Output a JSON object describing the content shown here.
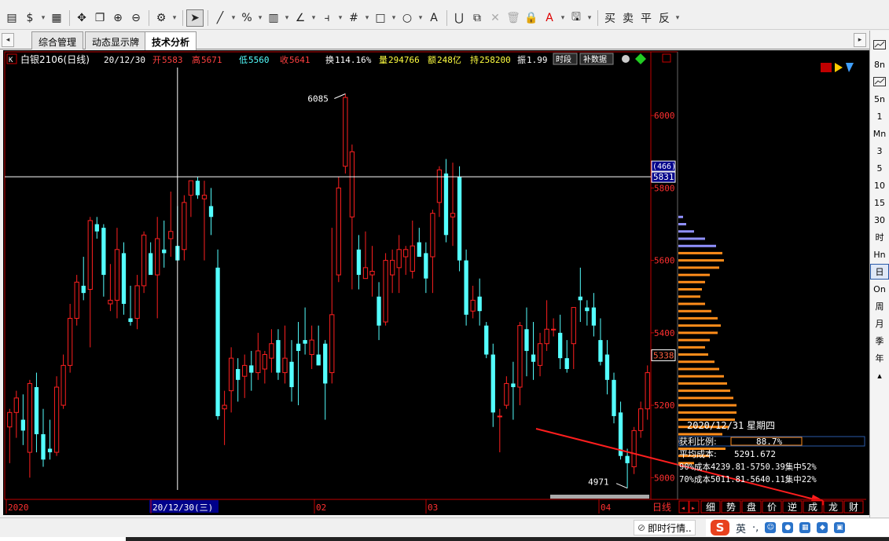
{
  "toolbar": {
    "items": [
      {
        "name": "document-icon",
        "glyph": "▤"
      },
      {
        "name": "currency-icon",
        "glyph": "$"
      },
      {
        "name": "currency-dropdown-icon",
        "glyph": "▾",
        "small": true
      },
      {
        "name": "grid-icon",
        "glyph": "▦"
      },
      {
        "name": "sep"
      },
      {
        "name": "move-icon",
        "glyph": "✥"
      },
      {
        "name": "copy-icon",
        "glyph": "❐"
      },
      {
        "name": "zoom-in-icon",
        "glyph": "⊕"
      },
      {
        "name": "zoom-out-icon",
        "glyph": "⊖"
      },
      {
        "name": "sep"
      },
      {
        "name": "settings-icon",
        "glyph": "⚙"
      },
      {
        "name": "settings-dropdown-icon",
        "glyph": "▾",
        "small": true
      },
      {
        "name": "sep"
      },
      {
        "name": "pointer-icon",
        "glyph": "➤",
        "active": true
      },
      {
        "name": "sep"
      },
      {
        "name": "line-tool-icon",
        "glyph": "╱"
      },
      {
        "name": "line-dropdown-icon",
        "glyph": "▾",
        "small": true
      },
      {
        "name": "percent-icon",
        "glyph": "%"
      },
      {
        "name": "percent-dropdown-icon",
        "glyph": "▾",
        "small": true
      },
      {
        "name": "ruler-icon",
        "glyph": "▥"
      },
      {
        "name": "ruler-dropdown-icon",
        "glyph": "▾",
        "small": true
      },
      {
        "name": "angle-icon",
        "glyph": "∠"
      },
      {
        "name": "angle-dropdown-icon",
        "glyph": "▾",
        "small": true
      },
      {
        "name": "fork-icon",
        "glyph": "⫞"
      },
      {
        "name": "fork-dropdown-icon",
        "glyph": "▾",
        "small": true
      },
      {
        "name": "hash-icon",
        "glyph": "#"
      },
      {
        "name": "hash-dropdown-icon",
        "glyph": "▾",
        "small": true
      },
      {
        "name": "rectangle-icon",
        "glyph": "□"
      },
      {
        "name": "rectangle-dropdown-icon",
        "glyph": "▾",
        "small": true
      },
      {
        "name": "circle-icon",
        "glyph": "○"
      },
      {
        "name": "circle-dropdown-icon",
        "glyph": "▾",
        "small": true
      },
      {
        "name": "text-icon",
        "glyph": "A"
      },
      {
        "name": "sep"
      },
      {
        "name": "magnet-icon",
        "glyph": "⋃"
      },
      {
        "name": "copy-shape-icon",
        "glyph": "⧉"
      },
      {
        "name": "delete-icon",
        "glyph": "✕",
        "gray": true
      },
      {
        "name": "trash-icon",
        "glyph": "🗑",
        "gray": true
      },
      {
        "name": "lock-icon",
        "glyph": "🔒"
      },
      {
        "name": "color-icon",
        "glyph": "A",
        "red": true
      },
      {
        "name": "color-dropdown-icon",
        "glyph": "▾",
        "small": true
      },
      {
        "name": "save-icon",
        "glyph": "🖫"
      },
      {
        "name": "save-dropdown-icon",
        "glyph": "▾",
        "small": true
      },
      {
        "name": "sep"
      },
      {
        "name": "buy-icon",
        "glyph": "买"
      },
      {
        "name": "sell-icon",
        "glyph": "卖"
      },
      {
        "name": "close-position-icon",
        "glyph": "平"
      },
      {
        "name": "reverse-icon",
        "glyph": "反"
      },
      {
        "name": "trade-dropdown-icon",
        "glyph": "▾",
        "small": true
      }
    ]
  },
  "tabs": {
    "left_arrow": "◂",
    "right_arrow": "▸",
    "items": [
      "综合管理",
      "动态显示牌",
      "技术分析"
    ],
    "active_index": 2
  },
  "info_bar": {
    "k_button": "K",
    "instrument": "白银2106(日线)",
    "date": "20/12/30",
    "open_label": "开",
    "open": "5583",
    "high_label": "高",
    "high": "5671",
    "low_label": "低",
    "low": "5560",
    "close_label": "收",
    "close": "5641",
    "turnover_label": "换",
    "turnover": "114.16%",
    "volume_label": "量",
    "volume": "294766",
    "amount_label": "额",
    "amount": "248亿",
    "oi_label": "持",
    "oi": "258200",
    "amplitude_label": "振",
    "amplitude": "1.99",
    "btn_period": "时段",
    "btn_fill": "补数据"
  },
  "price_axis": {
    "ticks": [
      "6000",
      "5800",
      "5600",
      "5400",
      "5200",
      "5000"
    ],
    "crosshair_count": "(466)",
    "crosshair_price": "5831",
    "last_price": "5338"
  },
  "annotations": {
    "high_label": "6085",
    "low_label": "4971"
  },
  "date_axis": {
    "labels": [
      "2020",
      "20/12/30(三)",
      "02",
      "03",
      "04"
    ],
    "period": "日线"
  },
  "cost_panel": {
    "date": "2020/12/31",
    "weekday": "星期四",
    "profit_ratio_label": "获利比例:",
    "profit_ratio": "88.7%",
    "avg_cost_label": "平均成本:",
    "avg_cost": "5291.672",
    "line90": "90%成本4239.81-5750.39集中52%",
    "line70": "70%成本5011.81-5640.11集中22%"
  },
  "bottom_tabs": {
    "nav_left": "◂",
    "nav_right": "▸",
    "items": [
      "细",
      "势",
      "盘",
      "价",
      "逆",
      "成",
      "龙",
      "财"
    ]
  },
  "right_panel": {
    "items": [
      "",
      "8n",
      "",
      "5n",
      "1",
      "Mn",
      "3",
      "5",
      "10",
      "15",
      "30",
      "时",
      "Hn",
      "日",
      "On",
      "周",
      "月",
      "季",
      "年",
      "▴"
    ],
    "active_index": 13
  },
  "statusbar": {
    "realtime": "即时行情..",
    "ime_logo": "S",
    "ime_lang": "英",
    "ime_punct": "·,"
  },
  "chart_data": {
    "type": "candlestick",
    "ylim": [
      4940,
      6150
    ],
    "colors": {
      "up": "#ff2020",
      "down": "#54ffff",
      "bg": "#000000",
      "axis": "#c00000",
      "text": "#ff3030",
      "profile_up": "#ff8c1a",
      "profile_down": "#9090ff"
    },
    "candles": [
      {
        "o": 5140,
        "h": 5190,
        "l": 5040,
        "c": 5180
      },
      {
        "o": 5180,
        "h": 5240,
        "l": 5110,
        "c": 5220
      },
      {
        "o": 5160,
        "h": 5230,
        "l": 5090,
        "c": 5130
      },
      {
        "o": 5070,
        "h": 5270,
        "l": 5000,
        "c": 5260
      },
      {
        "o": 5250,
        "h": 5290,
        "l": 5070,
        "c": 5120
      },
      {
        "o": 5120,
        "h": 5190,
        "l": 5030,
        "c": 5050
      },
      {
        "o": 5080,
        "h": 5160,
        "l": 5050,
        "c": 5070
      },
      {
        "o": 5070,
        "h": 5280,
        "l": 5060,
        "c": 5250
      },
      {
        "o": 5200,
        "h": 5340,
        "l": 5190,
        "c": 5310
      },
      {
        "o": 5310,
        "h": 5480,
        "l": 5290,
        "c": 5440
      },
      {
        "o": 5440,
        "h": 5560,
        "l": 5420,
        "c": 5540
      },
      {
        "o": 5530,
        "h": 5610,
        "l": 5490,
        "c": 5510
      },
      {
        "o": 5520,
        "h": 5720,
        "l": 5360,
        "c": 5710
      },
      {
        "o": 5700,
        "h": 5720,
        "l": 5660,
        "c": 5680
      },
      {
        "o": 5690,
        "h": 5700,
        "l": 5500,
        "c": 5560
      },
      {
        "o": 5480,
        "h": 5590,
        "l": 5460,
        "c": 5490
      },
      {
        "o": 5490,
        "h": 5690,
        "l": 5440,
        "c": 5630
      },
      {
        "o": 5620,
        "h": 5650,
        "l": 5450,
        "c": 5480
      },
      {
        "o": 5440,
        "h": 5530,
        "l": 5420,
        "c": 5430
      },
      {
        "o": 5440,
        "h": 5560,
        "l": 5410,
        "c": 5530
      },
      {
        "o": 5530,
        "h": 5680,
        "l": 5510,
        "c": 5670
      },
      {
        "o": 5620,
        "h": 5650,
        "l": 5590,
        "c": 5560
      },
      {
        "o": 5560,
        "h": 5720,
        "l": 5440,
        "c": 5660
      },
      {
        "o": 5630,
        "h": 5710,
        "l": 5580,
        "c": 5620
      },
      {
        "o": 5660,
        "h": 5790,
        "l": 5610,
        "c": 5680
      },
      {
        "o": 5640,
        "h": 5750,
        "l": 5600,
        "c": 5600
      },
      {
        "o": 5630,
        "h": 5780,
        "l": 5600,
        "c": 5760
      },
      {
        "o": 5780,
        "h": 5820,
        "l": 5720,
        "c": 5820
      },
      {
        "o": 5820,
        "h": 5830,
        "l": 5770,
        "c": 5780
      },
      {
        "o": 5770,
        "h": 5820,
        "l": 5600,
        "c": 5780
      },
      {
        "o": 5750,
        "h": 5800,
        "l": 5670,
        "c": 5720
      },
      {
        "o": 5580,
        "h": 5630,
        "l": 5160,
        "c": 5170
      },
      {
        "o": 5190,
        "h": 5240,
        "l": 5090,
        "c": 5200
      },
      {
        "o": 5240,
        "h": 5360,
        "l": 5180,
        "c": 5330
      },
      {
        "o": 5300,
        "h": 5330,
        "l": 5210,
        "c": 5270
      },
      {
        "o": 5280,
        "h": 5340,
        "l": 5220,
        "c": 5310
      },
      {
        "o": 5310,
        "h": 5350,
        "l": 5240,
        "c": 5290
      },
      {
        "o": 5290,
        "h": 5400,
        "l": 5270,
        "c": 5350
      },
      {
        "o": 5300,
        "h": 5350,
        "l": 5260,
        "c": 5340
      },
      {
        "o": 5330,
        "h": 5410,
        "l": 5290,
        "c": 5370
      },
      {
        "o": 5380,
        "h": 5410,
        "l": 5270,
        "c": 5290
      },
      {
        "o": 5290,
        "h": 5420,
        "l": 5260,
        "c": 5330
      },
      {
        "o": 5320,
        "h": 5380,
        "l": 5210,
        "c": 5250
      },
      {
        "o": 5370,
        "h": 5430,
        "l": 5200,
        "c": 5350
      },
      {
        "o": 5380,
        "h": 5470,
        "l": 5340,
        "c": 5370
      },
      {
        "o": 5340,
        "h": 5420,
        "l": 5300,
        "c": 5380
      },
      {
        "o": 5340,
        "h": 5420,
        "l": 5310,
        "c": 5310
      },
      {
        "o": 5370,
        "h": 5380,
        "l": 5160,
        "c": 5260
      },
      {
        "o": 5290,
        "h": 5690,
        "l": 5260,
        "c": 5450
      },
      {
        "o": 5560,
        "h": 5830,
        "l": 5540,
        "c": 5800
      },
      {
        "o": 5860,
        "h": 6060,
        "l": 5840,
        "c": 6050
      },
      {
        "o": 5720,
        "h": 5920,
        "l": 5520,
        "c": 5900
      },
      {
        "o": 5630,
        "h": 5670,
        "l": 5520,
        "c": 5560
      },
      {
        "o": 5550,
        "h": 5680,
        "l": 5560,
        "c": 5580
      },
      {
        "o": 5560,
        "h": 5640,
        "l": 5500,
        "c": 5570
      },
      {
        "o": 5500,
        "h": 5540,
        "l": 5380,
        "c": 5420
      },
      {
        "o": 5430,
        "h": 5620,
        "l": 5420,
        "c": 5600
      },
      {
        "o": 5560,
        "h": 5630,
        "l": 5510,
        "c": 5600
      },
      {
        "o": 5580,
        "h": 5670,
        "l": 5510,
        "c": 5630
      },
      {
        "o": 5610,
        "h": 5640,
        "l": 5560,
        "c": 5630
      },
      {
        "o": 5570,
        "h": 5710,
        "l": 5550,
        "c": 5640
      },
      {
        "o": 5650,
        "h": 5690,
        "l": 5620,
        "c": 5610
      },
      {
        "o": 5620,
        "h": 5650,
        "l": 5510,
        "c": 5550
      },
      {
        "o": 5610,
        "h": 5740,
        "l": 5510,
        "c": 5730
      },
      {
        "o": 5760,
        "h": 5860,
        "l": 5720,
        "c": 5850
      },
      {
        "o": 5840,
        "h": 5880,
        "l": 5650,
        "c": 5670
      },
      {
        "o": 5720,
        "h": 5870,
        "l": 5640,
        "c": 5730
      },
      {
        "o": 5830,
        "h": 5860,
        "l": 5570,
        "c": 5600
      },
      {
        "o": 5600,
        "h": 5630,
        "l": 5420,
        "c": 5450
      },
      {
        "o": 5460,
        "h": 5530,
        "l": 5440,
        "c": 5490
      },
      {
        "o": 5500,
        "h": 5550,
        "l": 5420,
        "c": 5460
      },
      {
        "o": 5420,
        "h": 5430,
        "l": 5330,
        "c": 5340
      },
      {
        "o": 5340,
        "h": 5370,
        "l": 5140,
        "c": 5180
      },
      {
        "o": 5170,
        "h": 5190,
        "l": 5070,
        "c": 5170
      },
      {
        "o": 5200,
        "h": 5280,
        "l": 5190,
        "c": 5260
      },
      {
        "o": 5260,
        "h": 5320,
        "l": 5160,
        "c": 5250
      },
      {
        "o": 5250,
        "h": 5430,
        "l": 5200,
        "c": 5420
      },
      {
        "o": 5410,
        "h": 5470,
        "l": 5280,
        "c": 5350
      },
      {
        "o": 5340,
        "h": 5430,
        "l": 5270,
        "c": 5320
      },
      {
        "o": 5310,
        "h": 5400,
        "l": 5280,
        "c": 5370
      },
      {
        "o": 5370,
        "h": 5490,
        "l": 5350,
        "c": 5410
      },
      {
        "o": 5410,
        "h": 5440,
        "l": 5390,
        "c": 5410
      },
      {
        "o": 5400,
        "h": 5450,
        "l": 5300,
        "c": 5330
      },
      {
        "o": 5330,
        "h": 5380,
        "l": 5290,
        "c": 5300
      },
      {
        "o": 5370,
        "h": 5440,
        "l": 5300,
        "c": 5470
      },
      {
        "o": 5500,
        "h": 5580,
        "l": 5430,
        "c": 5490
      },
      {
        "o": 5470,
        "h": 5490,
        "l": 5420,
        "c": 5460
      },
      {
        "o": 5470,
        "h": 5510,
        "l": 5390,
        "c": 5420
      },
      {
        "o": 5380,
        "h": 5440,
        "l": 5310,
        "c": 5320
      },
      {
        "o": 5340,
        "h": 5380,
        "l": 5230,
        "c": 5270
      },
      {
        "o": 5270,
        "h": 5290,
        "l": 5150,
        "c": 5170
      },
      {
        "o": 5180,
        "h": 5210,
        "l": 5050,
        "c": 5060
      },
      {
        "o": 5060,
        "h": 5080,
        "l": 4971,
        "c": 5040
      },
      {
        "o": 5030,
        "h": 5140,
        "l": 5010,
        "c": 5130
      },
      {
        "o": 5130,
        "h": 5210,
        "l": 5110,
        "c": 5190
      },
      {
        "o": 5190,
        "h": 5310,
        "l": 5160,
        "c": 5290
      }
    ],
    "crosshair": {
      "index": 25,
      "price": 5831
    },
    "arrow_label": "",
    "profile": [
      {
        "price": 5720,
        "len": 6,
        "down": true
      },
      {
        "price": 5700,
        "len": 10,
        "down": true
      },
      {
        "price": 5680,
        "len": 20,
        "down": true
      },
      {
        "price": 5660,
        "len": 34,
        "down": true
      },
      {
        "price": 5640,
        "len": 48,
        "down": true
      },
      {
        "price": 5620,
        "len": 56,
        "down": false
      },
      {
        "price": 5600,
        "len": 58,
        "down": false
      },
      {
        "price": 5580,
        "len": 52,
        "down": false
      },
      {
        "price": 5560,
        "len": 40,
        "down": false
      },
      {
        "price": 5540,
        "len": 34,
        "down": false
      },
      {
        "price": 5520,
        "len": 30,
        "down": false
      },
      {
        "price": 5500,
        "len": 28,
        "down": false
      },
      {
        "price": 5480,
        "len": 34,
        "down": false
      },
      {
        "price": 5460,
        "len": 42,
        "down": false
      },
      {
        "price": 5440,
        "len": 50,
        "down": false
      },
      {
        "price": 5420,
        "len": 54,
        "down": false
      },
      {
        "price": 5400,
        "len": 50,
        "down": false
      },
      {
        "price": 5380,
        "len": 40,
        "down": false
      },
      {
        "price": 5360,
        "len": 34,
        "down": false
      },
      {
        "price": 5340,
        "len": 38,
        "down": false
      },
      {
        "price": 5320,
        "len": 46,
        "down": false
      },
      {
        "price": 5300,
        "len": 52,
        "down": false
      },
      {
        "price": 5280,
        "len": 58,
        "down": false
      },
      {
        "price": 5260,
        "len": 62,
        "down": false
      },
      {
        "price": 5240,
        "len": 66,
        "down": false
      },
      {
        "price": 5220,
        "len": 70,
        "down": false
      },
      {
        "price": 5200,
        "len": 74,
        "down": false
      },
      {
        "price": 5180,
        "len": 74,
        "down": false
      },
      {
        "price": 5160,
        "len": 72,
        "down": false
      },
      {
        "price": 5140,
        "len": 64,
        "down": false
      },
      {
        "price": 5120,
        "len": 56,
        "down": false
      },
      {
        "price": 5100,
        "len": 70,
        "down": false
      },
      {
        "price": 5080,
        "len": 60,
        "down": false
      },
      {
        "price": 5060,
        "len": 40,
        "down": false
      },
      {
        "price": 5040,
        "len": 20,
        "down": false
      }
    ]
  }
}
